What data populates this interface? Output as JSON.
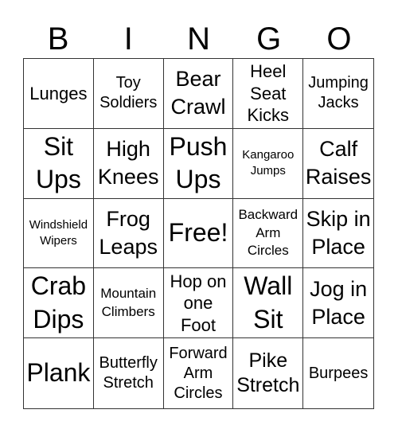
{
  "header": [
    "B",
    "I",
    "N",
    "G",
    "O"
  ],
  "cells": [
    "Lunges",
    "Toy Soldiers",
    "Bear Crawl",
    "Heel Seat Kicks",
    "Jumping Jacks",
    "Sit Ups",
    "High Knees",
    "Push Ups",
    "Kangaroo Jumps",
    "Calf Raises",
    "Windshield Wipers",
    "Frog Leaps",
    "Free!",
    "Backward Arm Circles",
    "Skip in Place",
    "Crab Dips",
    "Mountain Climbers",
    "Hop on one Foot",
    "Wall Sit",
    "Jog in Place",
    "Plank",
    "Butterfly Stretch",
    "Forward Arm Circles",
    "Pike Stretch",
    "Burpees"
  ]
}
